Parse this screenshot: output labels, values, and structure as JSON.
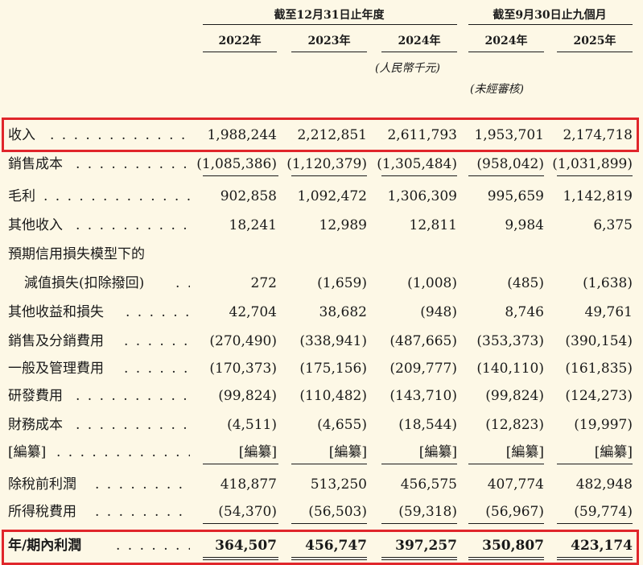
{
  "header": {
    "group_year_end": "截至12月31日止年度",
    "group_nine_months": "截至9月30日止九個月",
    "years": [
      "2022年",
      "2023年",
      "2024年",
      "2024年",
      "2025年"
    ],
    "currency_note": "(人民幣千元)",
    "unaudited_note": "(未經審核)"
  },
  "rows": [
    {
      "label": "收入",
      "values": [
        "1,988,244",
        "2,212,851",
        "2,611,793",
        "1,953,701",
        "2,174,718"
      ]
    },
    {
      "label": "銷售成本",
      "values": [
        "(1,085,386)",
        "(1,120,379)",
        "(1,305,484)",
        "(958,042)",
        "(1,031,899)"
      ]
    },
    {
      "label": "毛利",
      "values": [
        "902,858",
        "1,092,472",
        "1,306,309",
        "995,659",
        "1,142,819"
      ]
    },
    {
      "label": "其他收入",
      "values": [
        "18,241",
        "12,989",
        "12,811",
        "9,984",
        "6,375"
      ]
    },
    {
      "label": "預期信用損失模型下的",
      "values": [
        "",
        "",
        "",
        "",
        ""
      ]
    },
    {
      "label": "減值損失(扣除撥回)",
      "values": [
        "272",
        "(1,659)",
        "(1,008)",
        "(485)",
        "(1,638)"
      ]
    },
    {
      "label": "其他收益和損失",
      "values": [
        "42,704",
        "38,682",
        "(948)",
        "8,746",
        "49,761"
      ]
    },
    {
      "label": "銷售及分銷費用",
      "values": [
        "(270,490)",
        "(338,941)",
        "(487,665)",
        "(353,373)",
        "(390,154)"
      ]
    },
    {
      "label": "一般及管理費用",
      "values": [
        "(170,373)",
        "(175,156)",
        "(209,777)",
        "(140,110)",
        "(161,835)"
      ]
    },
    {
      "label": "研發費用",
      "values": [
        "(99,824)",
        "(110,482)",
        "(143,710)",
        "(99,824)",
        "(124,273)"
      ]
    },
    {
      "label": "財務成本",
      "values": [
        "(4,511)",
        "(4,655)",
        "(18,544)",
        "(12,823)",
        "(19,997)"
      ]
    },
    {
      "label": "[編纂]",
      "values": [
        "[編纂]",
        "[編纂]",
        "[編纂]",
        "[編纂]",
        "[編纂]"
      ]
    },
    {
      "label": "除稅前利潤",
      "values": [
        "418,877",
        "513,250",
        "456,575",
        "407,774",
        "482,948"
      ]
    },
    {
      "label": "所得稅費用",
      "values": [
        "(54,370)",
        "(56,503)",
        "(59,318)",
        "(56,967)",
        "(59,774)"
      ]
    },
    {
      "label": "年/期內利潤",
      "values": [
        "364,507",
        "456,747",
        "397,257",
        "350,807",
        "423,174"
      ]
    }
  ],
  "colors": {
    "background": "#fdf8e6",
    "highlight": "#e0262b",
    "text": "#1a1a1a"
  }
}
